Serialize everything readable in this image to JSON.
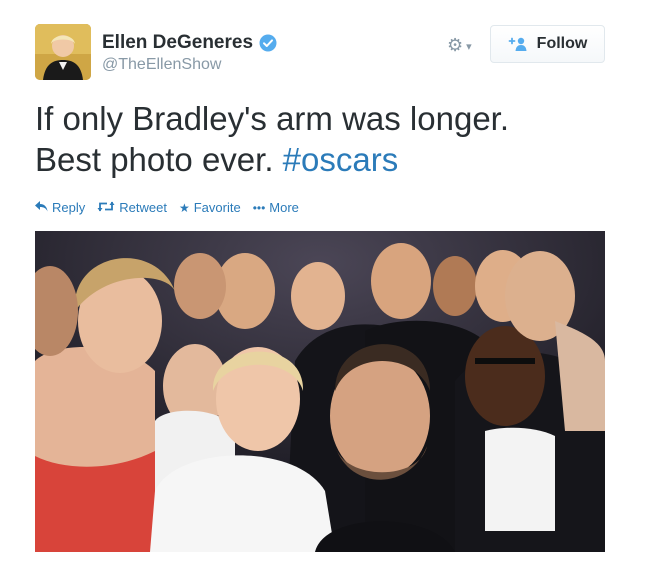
{
  "user": {
    "name": "Ellen DeGeneres",
    "handle": "@TheEllenShow",
    "verified": true
  },
  "header": {
    "settings_icon": "gear-icon",
    "follow_label": "Follow"
  },
  "tweet": {
    "text_line1": "If only Bradley's arm was longer.",
    "text_line2_prefix": "Best photo ever. ",
    "hashtag": "#oscars"
  },
  "actions": [
    {
      "label": "Reply",
      "icon": "reply-icon"
    },
    {
      "label": "Retweet",
      "icon": "retweet-icon"
    },
    {
      "label": "Favorite",
      "icon": "star-icon"
    },
    {
      "label": "More",
      "icon": "more-icon"
    }
  ],
  "colors": {
    "link": "#2b7bb9",
    "text": "#292f33",
    "muted": "#8899a6",
    "verified": "#55acee"
  }
}
